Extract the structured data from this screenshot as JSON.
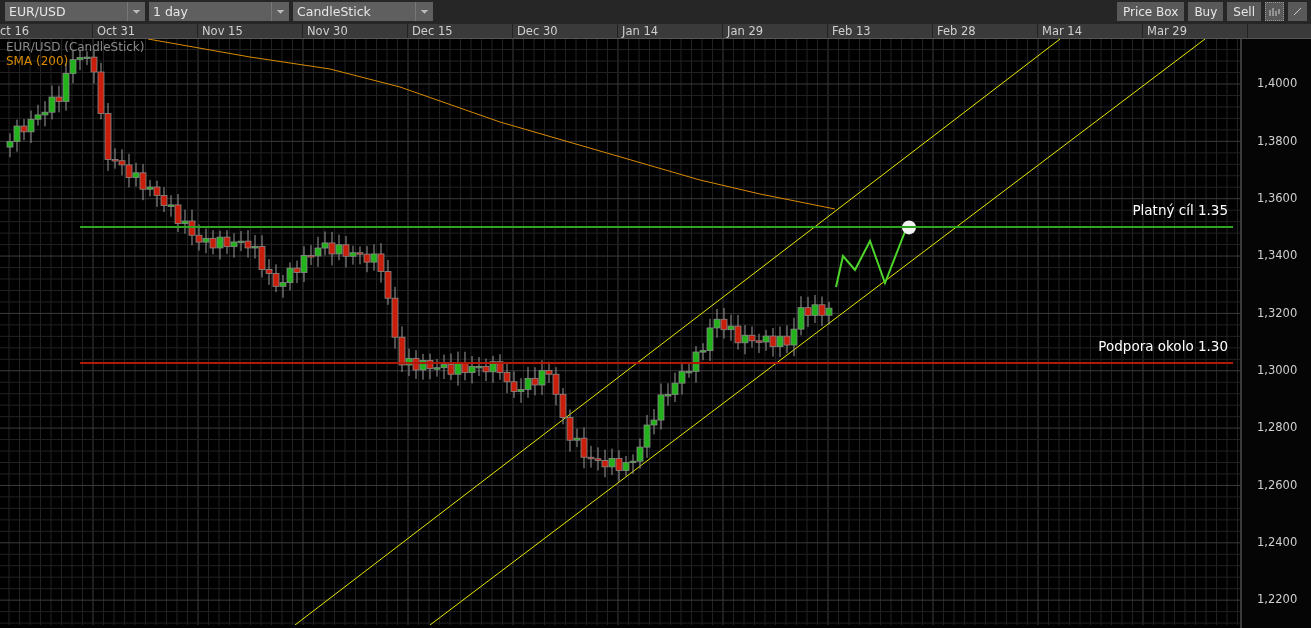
{
  "toolbar": {
    "dropdowns": [
      {
        "value": "EUR/USD"
      },
      {
        "value": "1 day"
      },
      {
        "value": "CandleStick"
      }
    ],
    "buttons": [
      "Price Box",
      "Buy",
      "Sell"
    ],
    "tools": [
      {
        "kind": "bars",
        "selected": true
      },
      {
        "kind": "line",
        "selected": false
      }
    ]
  },
  "date_axis": [
    "ct 16",
    "Oct 31",
    "Nov 15",
    "Nov 30",
    "Dec 15",
    "Dec 30",
    "Jan 14",
    "Jan 29",
    "Feb 13",
    "Feb 28",
    "Mar 14",
    "Mar 29"
  ],
  "legend": [
    {
      "label": "EUR/USD (CandleStick)",
      "kind": "price"
    },
    {
      "label": "SMA (200)",
      "kind": "indicator"
    }
  ],
  "annotations": [
    {
      "label": "Platný cíl 1.35",
      "color": "#2fa51f"
    },
    {
      "label": "Podpora okolo 1.30",
      "color": "#b01808"
    }
  ],
  "price_axis": [
    "1,4000",
    "1,3800",
    "1,3600",
    "1,3400",
    "1,3200",
    "1,3000",
    "1,2800",
    "1,2600",
    "1,2400",
    "1,2200"
  ]
}
